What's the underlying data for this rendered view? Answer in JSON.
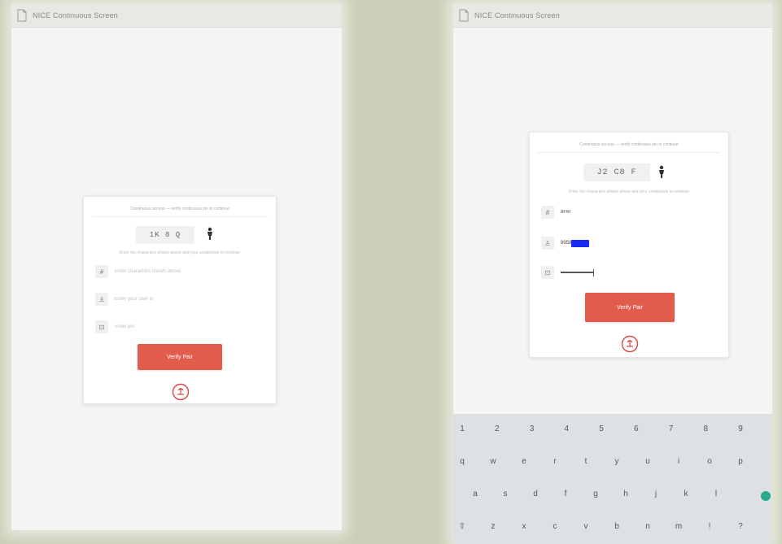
{
  "left_screen": {
    "title": "NICE Continuous Screen",
    "header_note": "Continuous access — verify continuous pin to continue",
    "captcha": "1K 8 Q",
    "hint": "Enter the characters shown above and your credentials to continue",
    "fields": [
      {
        "icon": "#",
        "placeholder": "Enter characters shown above"
      },
      {
        "icon": "♙",
        "placeholder": "Enter your user id"
      },
      {
        "icon": "⊡",
        "placeholder": "Enter pin"
      }
    ],
    "button_label": "Verify Pair"
  },
  "right_screen": {
    "title": "NICE Continuous Screen",
    "header_note": "Continuous access — verify continuous pin to continue",
    "captcha": "J2 C8 F",
    "hint": "Enter the characters shown above and your credentials to continue",
    "fields": [
      {
        "icon": "#",
        "value": "8F6I"
      },
      {
        "icon": "♙",
        "value": "9958"
      },
      {
        "icon": "⊡",
        "value": ""
      }
    ],
    "button_label": "Verify Pair",
    "keyboard": {
      "digits": [
        "1",
        "2",
        "3",
        "4",
        "5",
        "6",
        "7",
        "8",
        "9"
      ],
      "row1": [
        "q",
        "w",
        "e",
        "r",
        "t",
        "y",
        "u",
        "i",
        "o",
        "p"
      ],
      "row2": [
        "a",
        "s",
        "d",
        "f",
        "g",
        "h",
        "j",
        "k",
        "l"
      ],
      "row3": [
        "⇧",
        "z",
        "x",
        "c",
        "v",
        "b",
        "n",
        "m",
        "!",
        "?"
      ]
    }
  },
  "colors": {
    "accent": "#e25c4c",
    "pin_mask": "#1a2af0",
    "background": "#c9cfb9"
  },
  "icons": [
    "app-document-icon",
    "person-icon",
    "hash-icon",
    "user-icon",
    "lock-icon",
    "nic-logo-icon"
  ]
}
